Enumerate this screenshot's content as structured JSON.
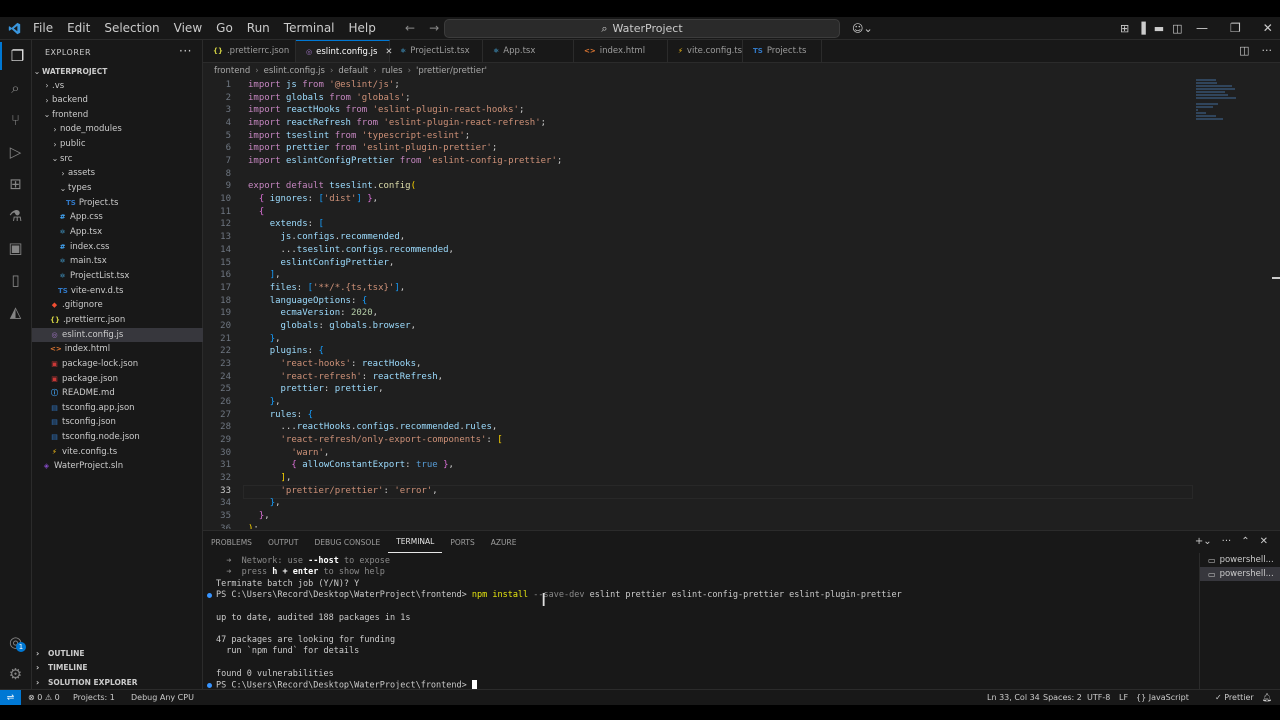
{
  "menu": [
    "File",
    "Edit",
    "Selection",
    "View",
    "Go",
    "Run",
    "Terminal",
    "Help"
  ],
  "search": {
    "text": "WaterProject"
  },
  "explorer": {
    "title": "EXPLORER",
    "root": "WATERPROJECT",
    "items": [
      {
        "label": ".vs",
        "kind": "folder",
        "depth": 1,
        "open": false
      },
      {
        "label": "backend",
        "kind": "folder",
        "depth": 1,
        "open": false
      },
      {
        "label": "frontend",
        "kind": "folder",
        "depth": 1,
        "open": true
      },
      {
        "label": "node_modules",
        "kind": "folder",
        "depth": 2,
        "open": false
      },
      {
        "label": "public",
        "kind": "folder",
        "depth": 2,
        "open": false
      },
      {
        "label": "src",
        "kind": "folder",
        "depth": 2,
        "open": true
      },
      {
        "label": "assets",
        "kind": "folder",
        "depth": 3,
        "open": false
      },
      {
        "label": "types",
        "kind": "folder",
        "depth": 3,
        "open": true
      },
      {
        "label": "Project.ts",
        "kind": "ts",
        "depth": 4
      },
      {
        "label": "App.css",
        "kind": "css",
        "depth": 3
      },
      {
        "label": "App.tsx",
        "kind": "tsx",
        "depth": 3
      },
      {
        "label": "index.css",
        "kind": "css",
        "depth": 3
      },
      {
        "label": "main.tsx",
        "kind": "tsx",
        "depth": 3
      },
      {
        "label": "ProjectList.tsx",
        "kind": "tsx",
        "depth": 3
      },
      {
        "label": "vite-env.d.ts",
        "kind": "ts",
        "depth": 3
      },
      {
        "label": ".gitignore",
        "kind": "git",
        "depth": 2
      },
      {
        "label": ".prettierrc.json",
        "kind": "json",
        "depth": 2
      },
      {
        "label": "eslint.config.js",
        "kind": "eslint",
        "depth": 2,
        "selected": true
      },
      {
        "label": "index.html",
        "kind": "html",
        "depth": 2
      },
      {
        "label": "package-lock.json",
        "kind": "npm",
        "depth": 2
      },
      {
        "label": "package.json",
        "kind": "npm",
        "depth": 2
      },
      {
        "label": "README.md",
        "kind": "md",
        "depth": 2
      },
      {
        "label": "tsconfig.app.json",
        "kind": "tsconfig",
        "depth": 2
      },
      {
        "label": "tsconfig.json",
        "kind": "tsconfig",
        "depth": 2
      },
      {
        "label": "tsconfig.node.json",
        "kind": "tsconfig",
        "depth": 2
      },
      {
        "label": "vite.config.ts",
        "kind": "vite",
        "depth": 2
      },
      {
        "label": "WaterProject.sln",
        "kind": "sln",
        "depth": 1
      }
    ],
    "sections": [
      "OUTLINE",
      "TIMELINE",
      "SOLUTION EXPLORER"
    ]
  },
  "tabs": [
    {
      "label": ".prettierrc.json",
      "icon": "{}",
      "active": false
    },
    {
      "label": "eslint.config.js",
      "icon": "◎",
      "active": true
    },
    {
      "label": "ProjectList.tsx",
      "icon": "⚛",
      "active": false
    },
    {
      "label": "App.tsx",
      "icon": "⚛",
      "active": false
    },
    {
      "label": "index.html",
      "icon": "<>",
      "active": false
    },
    {
      "label": "vite.config.ts",
      "icon": "⚡",
      "active": false
    },
    {
      "label": "Project.ts",
      "icon": "TS",
      "active": false
    }
  ],
  "breadcrumb": [
    "frontend",
    "eslint.config.js",
    "default",
    "rules",
    "'prettier/prettier'"
  ],
  "code": {
    "current_line": 33,
    "lines": [
      [
        [
          "kw",
          "import "
        ],
        [
          "id",
          "js"
        ],
        [
          "kw",
          " from "
        ],
        [
          "str",
          "'@eslint/js'"
        ],
        [
          "plain",
          ";"
        ]
      ],
      [
        [
          "kw",
          "import "
        ],
        [
          "id",
          "globals"
        ],
        [
          "kw",
          " from "
        ],
        [
          "str",
          "'globals'"
        ],
        [
          "plain",
          ";"
        ]
      ],
      [
        [
          "kw",
          "import "
        ],
        [
          "id",
          "reactHooks"
        ],
        [
          "kw",
          " from "
        ],
        [
          "str",
          "'eslint-plugin-react-hooks'"
        ],
        [
          "plain",
          ";"
        ]
      ],
      [
        [
          "kw",
          "import "
        ],
        [
          "id",
          "reactRefresh"
        ],
        [
          "kw",
          " from "
        ],
        [
          "str",
          "'eslint-plugin-react-refresh'"
        ],
        [
          "plain",
          ";"
        ]
      ],
      [
        [
          "kw",
          "import "
        ],
        [
          "id",
          "tseslint"
        ],
        [
          "kw",
          " from "
        ],
        [
          "str",
          "'typescript-eslint'"
        ],
        [
          "plain",
          ";"
        ]
      ],
      [
        [
          "kw",
          "import "
        ],
        [
          "id",
          "prettier"
        ],
        [
          "kw",
          " from "
        ],
        [
          "str",
          "'eslint-plugin-prettier'"
        ],
        [
          "plain",
          ";"
        ]
      ],
      [
        [
          "kw",
          "import "
        ],
        [
          "id",
          "eslintConfigPrettier"
        ],
        [
          "kw",
          " from "
        ],
        [
          "str",
          "'eslint-config-prettier'"
        ],
        [
          "plain",
          ";"
        ]
      ],
      [],
      [
        [
          "kw",
          "export default "
        ],
        [
          "id",
          "tseslint"
        ],
        [
          "plain",
          "."
        ],
        [
          "fn",
          "config"
        ],
        [
          "pn",
          "("
        ]
      ],
      [
        [
          "plain",
          "  "
        ],
        [
          "pn2",
          "{"
        ],
        [
          "id",
          " ignores"
        ],
        [
          "plain",
          ": "
        ],
        [
          "pn3",
          "["
        ],
        [
          "str",
          "'dist'"
        ],
        [
          "pn3",
          "]"
        ],
        [
          "plain",
          " "
        ],
        [
          "pn2",
          "}"
        ],
        [
          "plain",
          ","
        ]
      ],
      [
        [
          "plain",
          "  "
        ],
        [
          "pn2",
          "{"
        ]
      ],
      [
        [
          "plain",
          "    "
        ],
        [
          "id",
          "extends"
        ],
        [
          "plain",
          ": "
        ],
        [
          "pn3",
          "["
        ]
      ],
      [
        [
          "plain",
          "      "
        ],
        [
          "id",
          "js"
        ],
        [
          "plain",
          "."
        ],
        [
          "id",
          "configs"
        ],
        [
          "plain",
          "."
        ],
        [
          "id",
          "recommended"
        ],
        [
          "plain",
          ","
        ]
      ],
      [
        [
          "plain",
          "      ..."
        ],
        [
          "id",
          "tseslint"
        ],
        [
          "plain",
          "."
        ],
        [
          "id",
          "configs"
        ],
        [
          "plain",
          "."
        ],
        [
          "id",
          "recommended"
        ],
        [
          "plain",
          ","
        ]
      ],
      [
        [
          "plain",
          "      "
        ],
        [
          "id",
          "eslintConfigPrettier"
        ],
        [
          "plain",
          ","
        ]
      ],
      [
        [
          "plain",
          "    "
        ],
        [
          "pn3",
          "]"
        ],
        [
          "plain",
          ","
        ]
      ],
      [
        [
          "plain",
          "    "
        ],
        [
          "id",
          "files"
        ],
        [
          "plain",
          ": "
        ],
        [
          "pn3",
          "["
        ],
        [
          "str",
          "'**/*.{ts,tsx}'"
        ],
        [
          "pn3",
          "]"
        ],
        [
          "plain",
          ","
        ]
      ],
      [
        [
          "plain",
          "    "
        ],
        [
          "id",
          "languageOptions"
        ],
        [
          "plain",
          ": "
        ],
        [
          "pn3",
          "{"
        ]
      ],
      [
        [
          "plain",
          "      "
        ],
        [
          "id",
          "ecmaVersion"
        ],
        [
          "plain",
          ": "
        ],
        [
          "num",
          "2020"
        ],
        [
          "plain",
          ","
        ]
      ],
      [
        [
          "plain",
          "      "
        ],
        [
          "id",
          "globals"
        ],
        [
          "plain",
          ": "
        ],
        [
          "id",
          "globals"
        ],
        [
          "plain",
          "."
        ],
        [
          "id",
          "browser"
        ],
        [
          "plain",
          ","
        ]
      ],
      [
        [
          "plain",
          "    "
        ],
        [
          "pn3",
          "}"
        ],
        [
          "plain",
          ","
        ]
      ],
      [
        [
          "plain",
          "    "
        ],
        [
          "id",
          "plugins"
        ],
        [
          "plain",
          ": "
        ],
        [
          "pn3",
          "{"
        ]
      ],
      [
        [
          "plain",
          "      "
        ],
        [
          "str",
          "'react-hooks'"
        ],
        [
          "plain",
          ": "
        ],
        [
          "id",
          "reactHooks"
        ],
        [
          "plain",
          ","
        ]
      ],
      [
        [
          "plain",
          "      "
        ],
        [
          "str",
          "'react-refresh'"
        ],
        [
          "plain",
          ": "
        ],
        [
          "id",
          "reactRefresh"
        ],
        [
          "plain",
          ","
        ]
      ],
      [
        [
          "plain",
          "      "
        ],
        [
          "id",
          "prettier"
        ],
        [
          "plain",
          ": "
        ],
        [
          "id",
          "prettier"
        ],
        [
          "plain",
          ","
        ]
      ],
      [
        [
          "plain",
          "    "
        ],
        [
          "pn3",
          "}"
        ],
        [
          "plain",
          ","
        ]
      ],
      [
        [
          "plain",
          "    "
        ],
        [
          "id",
          "rules"
        ],
        [
          "plain",
          ": "
        ],
        [
          "pn3",
          "{"
        ]
      ],
      [
        [
          "plain",
          "      ..."
        ],
        [
          "id",
          "reactHooks"
        ],
        [
          "plain",
          "."
        ],
        [
          "id",
          "configs"
        ],
        [
          "plain",
          "."
        ],
        [
          "id",
          "recommended"
        ],
        [
          "plain",
          "."
        ],
        [
          "id",
          "rules"
        ],
        [
          "plain",
          ","
        ]
      ],
      [
        [
          "plain",
          "      "
        ],
        [
          "str",
          "'react-refresh/only-export-components'"
        ],
        [
          "plain",
          ": "
        ],
        [
          "pn",
          "["
        ]
      ],
      [
        [
          "plain",
          "        "
        ],
        [
          "str",
          "'warn'"
        ],
        [
          "plain",
          ","
        ]
      ],
      [
        [
          "plain",
          "        "
        ],
        [
          "pn2",
          "{"
        ],
        [
          "id",
          " allowConstantExport"
        ],
        [
          "plain",
          ": "
        ],
        [
          "kw2",
          "true"
        ],
        [
          "plain",
          " "
        ],
        [
          "pn2",
          "}"
        ],
        [
          "plain",
          ","
        ]
      ],
      [
        [
          "plain",
          "      "
        ],
        [
          "pn",
          "]"
        ],
        [
          "plain",
          ","
        ]
      ],
      [
        [
          "plain",
          "      "
        ],
        [
          "str",
          "'prettier/prettier'"
        ],
        [
          "plain",
          ": "
        ],
        [
          "str",
          "'error'"
        ],
        [
          "plain",
          ","
        ]
      ],
      [
        [
          "plain",
          "    "
        ],
        [
          "pn3",
          "}"
        ],
        [
          "plain",
          ","
        ]
      ],
      [
        [
          "plain",
          "  "
        ],
        [
          "pn2",
          "}"
        ],
        [
          "plain",
          ","
        ]
      ],
      [
        [
          "pn",
          ")"
        ],
        [
          "plain",
          ";"
        ]
      ]
    ]
  },
  "panel": {
    "tabs": [
      "PROBLEMS",
      "OUTPUT",
      "DEBUG CONSOLE",
      "TERMINAL",
      "PORTS",
      "AZURE"
    ],
    "active": "TERMINAL",
    "terminal_lines": [
      {
        "parts": [
          [
            "dim",
            "  ➜  Network: use "
          ],
          [
            "bold",
            "--host"
          ],
          [
            "dim",
            " to expose"
          ]
        ]
      },
      {
        "parts": [
          [
            "dim",
            "  ➜  press "
          ],
          [
            "bold",
            "h + enter"
          ],
          [
            "dim",
            " to show help"
          ]
        ]
      },
      {
        "parts": [
          [
            "plain",
            "Terminate batch job (Y/N)? Y"
          ]
        ]
      },
      {
        "dot": true,
        "parts": [
          [
            "plain",
            "PS C:\\Users\\Record\\Desktop\\WaterProject\\frontend> "
          ],
          [
            "cmd",
            "npm install "
          ],
          [
            "dim",
            "--save-dev"
          ],
          [
            "plain",
            " eslint prettier eslint-config-prettier eslint-plugin-prettier"
          ]
        ]
      },
      {
        "parts": [
          [
            "plain",
            ""
          ]
        ]
      },
      {
        "parts": [
          [
            "plain",
            "up to date, audited 188 packages in 1s"
          ]
        ]
      },
      {
        "parts": [
          [
            "plain",
            ""
          ]
        ]
      },
      {
        "parts": [
          [
            "plain",
            "47 packages are looking for funding"
          ]
        ]
      },
      {
        "parts": [
          [
            "plain",
            "  run `npm fund` for details"
          ]
        ]
      },
      {
        "parts": [
          [
            "plain",
            ""
          ]
        ]
      },
      {
        "parts": [
          [
            "plain",
            "found "
          ],
          [
            "num",
            "0"
          ],
          [
            "plain",
            " vulnerabilities"
          ]
        ]
      },
      {
        "dot": true,
        "cursor": true,
        "parts": [
          [
            "plain",
            "PS C:\\Users\\Record\\Desktop\\WaterProject\\frontend> "
          ]
        ]
      }
    ],
    "terminals": [
      "powershell...",
      "powershell..."
    ]
  },
  "status": {
    "errors": "0",
    "warnings": "0",
    "projects": "Projects: 1",
    "debug": "Debug Any CPU",
    "position": "Ln 33, Col 34",
    "spaces": "Spaces: 2",
    "encoding": "UTF-8",
    "eol": "LF",
    "language": "JavaScript",
    "formatter": "Prettier"
  },
  "colors": {
    "accent": "#0078d4",
    "background": "#1f1f1f",
    "sidebar": "#181818"
  }
}
